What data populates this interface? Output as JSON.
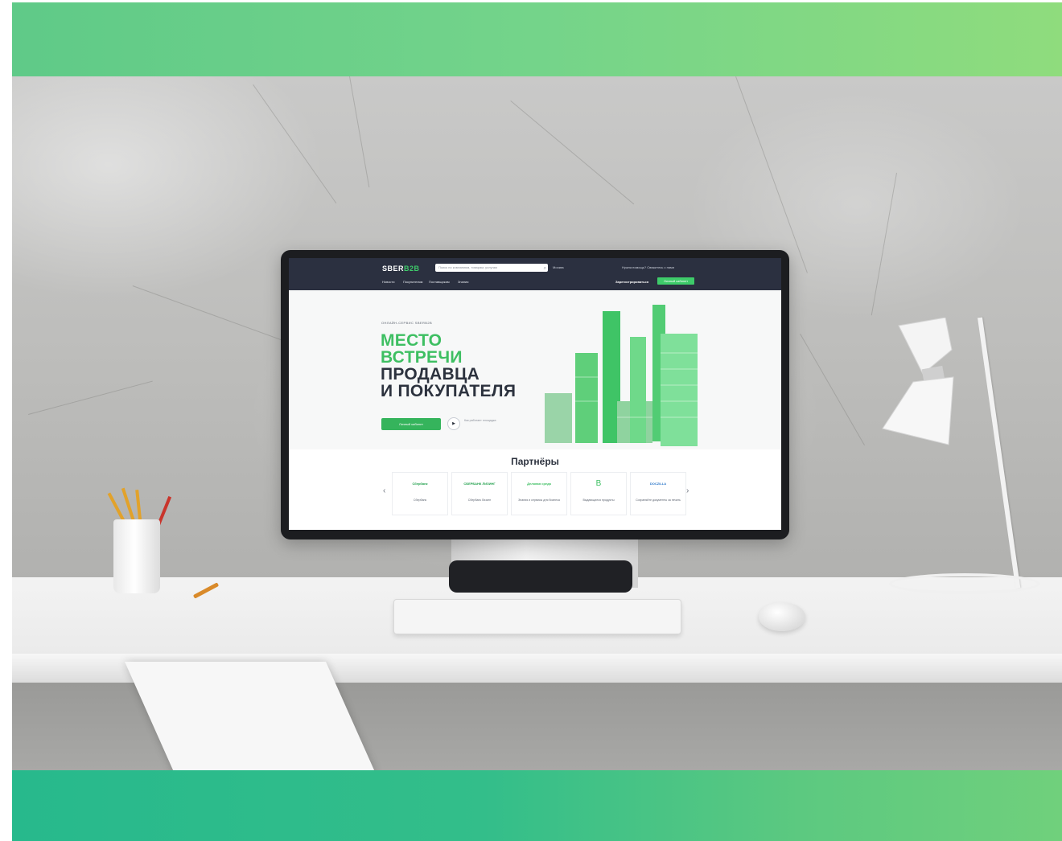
{
  "colors": {
    "brand_green": "#3ebf62",
    "header_dark": "#2b3040",
    "text_dark": "#2c323e",
    "band_top": "#74d48a",
    "band_bottom": "#33be8a"
  },
  "website": {
    "logo": {
      "main": "SBER",
      "accent": "B2B"
    },
    "search_placeholder": "Поиск по компаниям, товарам, услугам",
    "city": "Москва",
    "help": "Нужна помощь? Свяжитесь с нами",
    "nav": [
      "Новости",
      "Покупателям",
      "Поставщикам",
      "Знания"
    ],
    "register_label": "Зарегистрироваться",
    "login_label": "Личный кабинет",
    "hero": {
      "eyebrow": "ОНЛАЙН-СЕРВИС SBERB2B",
      "line1": "МЕСТО",
      "line2": "ВСТРЕЧИ",
      "line3": "ПРОДАВЦА",
      "line4": "И ПОКУПАТЕЛЯ",
      "button": "Личный кабинет",
      "video_text": "Как работает площадка"
    },
    "partners": {
      "title": "Партнёры",
      "items": [
        {
          "logo": "Сбербанк",
          "caption": "Сбербанк"
        },
        {
          "logo": "СБЕРБАНК ЛИЗИНГ",
          "caption": "Сбербанк Лизинг"
        },
        {
          "logo": "Деловая среда",
          "caption": "Знания и сервисы для бизнеса"
        },
        {
          "logo": "B",
          "caption": "Выдающиеся продукты"
        },
        {
          "logo": "DOCZILLA",
          "caption": "Сохраняйте документы за печать"
        }
      ]
    }
  },
  "icons": [
    "search-icon",
    "play-icon",
    "chevron-left-icon",
    "chevron-right-icon"
  ]
}
